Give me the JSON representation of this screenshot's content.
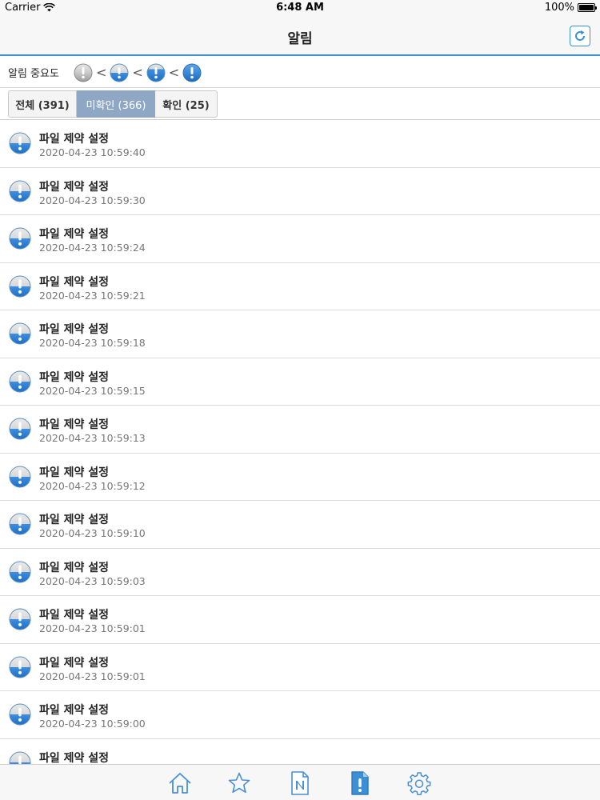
{
  "status_bar": {
    "carrier": "Carrier",
    "time": "6:48 AM",
    "battery": "100%"
  },
  "nav": {
    "title": "알림",
    "refresh_icon": "refresh-icon"
  },
  "importance": {
    "label": "알림 중요도",
    "levels": [
      "level-1",
      "level-2",
      "level-3",
      "level-4"
    ],
    "separator": "<"
  },
  "tabs": [
    {
      "label": "전체 (391)",
      "active": false
    },
    {
      "label": "미확인 (366)",
      "active": true
    },
    {
      "label": "확인 (25)",
      "active": false
    }
  ],
  "items": [
    {
      "title": "파일 제약 설정",
      "time": "2020-04-23 10:59:40"
    },
    {
      "title": "파일 제약 설정",
      "time": "2020-04-23 10:59:30"
    },
    {
      "title": "파일 제약 설정",
      "time": "2020-04-23 10:59:24"
    },
    {
      "title": "파일 제약 설정",
      "time": "2020-04-23 10:59:21"
    },
    {
      "title": "파일 제약 설정",
      "time": "2020-04-23 10:59:18"
    },
    {
      "title": "파일 제약 설정",
      "time": "2020-04-23 10:59:15"
    },
    {
      "title": "파일 제약 설정",
      "time": "2020-04-23 10:59:13"
    },
    {
      "title": "파일 제약 설정",
      "time": "2020-04-23 10:59:12"
    },
    {
      "title": "파일 제약 설정",
      "time": "2020-04-23 10:59:10"
    },
    {
      "title": "파일 제약 설정",
      "time": "2020-04-23 10:59:03"
    },
    {
      "title": "파일 제약 설정",
      "time": "2020-04-23 10:59:01"
    },
    {
      "title": "파일 제약 설정",
      "time": "2020-04-23 10:59:01"
    },
    {
      "title": "파일 제약 설정",
      "time": "2020-04-23 10:59:00"
    },
    {
      "title": "파일 제약 설정",
      "time": ""
    }
  ],
  "tab_bar": {
    "icons": [
      "home-icon",
      "star-icon",
      "notice-icon",
      "alert-icon",
      "settings-icon"
    ],
    "active": "alert-icon"
  },
  "colors": {
    "accent": "#3a8fd6",
    "tab_active": "#8ea7c4"
  }
}
